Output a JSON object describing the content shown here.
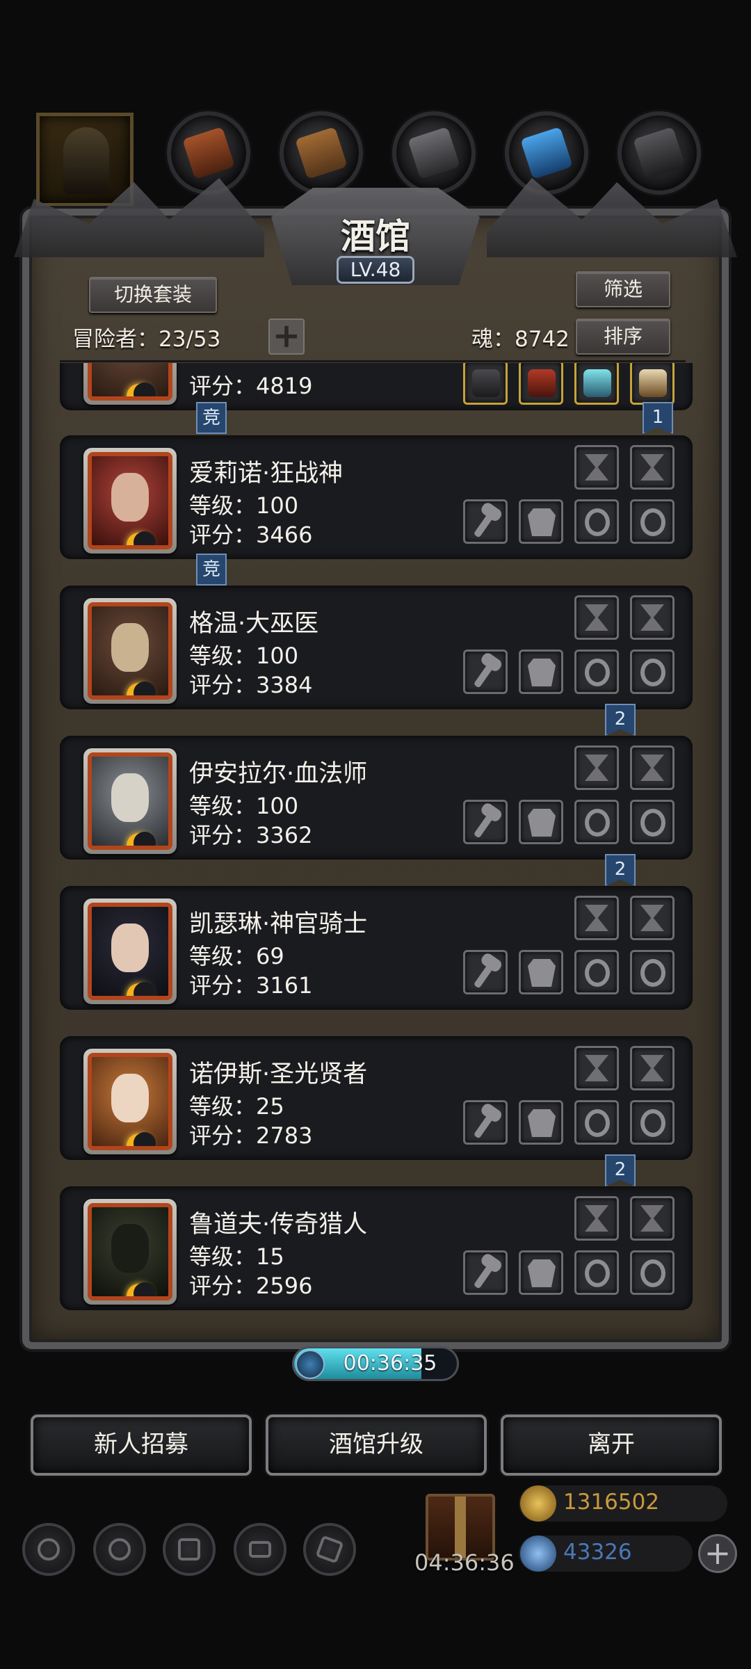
{
  "panel": {
    "title": "酒馆",
    "level": "LV.48",
    "switch_set_label": "切换套装",
    "filter_label": "筛选",
    "sort_label": "排序",
    "adventurers_label": "冒险者：23/53",
    "add_label": "+",
    "soul_label": "魂：8742"
  },
  "heroes": [
    {
      "name": "",
      "level": "",
      "score": "评分：4819",
      "tag": "竞",
      "badge": "1"
    },
    {
      "name": "爱莉诺·狂战神",
      "level": "等级：100",
      "score": "评分：3466",
      "tag": "竞",
      "badge": ""
    },
    {
      "name": "格温·大巫医",
      "level": "等级：100",
      "score": "评分：3384",
      "tag": "",
      "badge": "2"
    },
    {
      "name": "伊安拉尔·血法师",
      "level": "等级：100",
      "score": "评分：3362",
      "tag": "",
      "badge": "2"
    },
    {
      "name": "凯瑟琳·神官骑士",
      "level": "等级：69",
      "score": "评分：3161",
      "tag": "",
      "badge": ""
    },
    {
      "name": "诺伊斯·圣光贤者",
      "level": "等级：25",
      "score": "评分：2783",
      "tag": "",
      "badge": "2"
    },
    {
      "name": "鲁道夫·传奇猎人",
      "level": "等级：15",
      "score": "评分：2596",
      "tag": "",
      "badge": ""
    }
  ],
  "timer": {
    "text": "00:36:35",
    "progress": 0.78
  },
  "actions": {
    "recruit_label": "新人招募",
    "upgrade_label": "酒馆升级",
    "leave_label": "离开"
  },
  "dock": {
    "gift_timer": "04:36:36",
    "gold": "1316502",
    "gems": "43326",
    "add_label": "+"
  },
  "colors": {
    "accent_blue": "#26466e",
    "portrait_frame": "#b2451c",
    "gold_text": "#c89a3c",
    "gem_text": "#4a78b8",
    "timer_fill": "#3cc3d3"
  },
  "icons": [
    "hero-tab-icon",
    "boots-tab-icon",
    "leather-tab-icon",
    "ingot-tab-icon",
    "crystal-tab-icon",
    "anvil-tab-icon",
    "rune-slot-icon",
    "weapon-slot-icon",
    "armor-slot-icon",
    "ring-slot-icon",
    "clock-icon",
    "gift-icon",
    "gold-coin-icon",
    "gem-icon",
    "settings-icon",
    "achievement-icon",
    "guild-icon",
    "mail-icon",
    "shop-icon"
  ]
}
